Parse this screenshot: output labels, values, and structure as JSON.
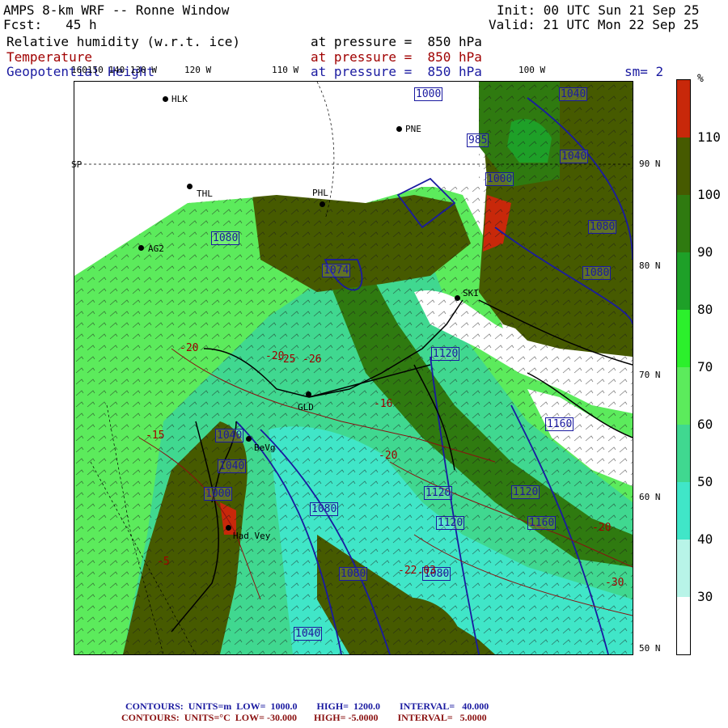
{
  "header": {
    "title": "AMPS 8-km WRF -- Ronne Window",
    "fcst": "Fcst:   45 h",
    "init": "Init: 00 UTC Sun 21 Sep 25",
    "valid": "Valid: 21 UTC Mon 22 Sep 25",
    "field1": "Relative humidity (w.r.t. ice)",
    "field2": "Temperature",
    "field3": "Geopotential Height",
    "level1": "at pressure =  850 hPa",
    "level2": "at pressure =  850 hPa",
    "level3": "at pressure =  850 hPa",
    "smooth": "sm= 2"
  },
  "top_longitudes": [
    "160150 140 130 W",
    "120 W",
    "110 W",
    "100 W"
  ],
  "right_latitudes": [
    "90 N",
    "80 N",
    "70 N",
    "60 N",
    "50 N"
  ],
  "left_edge_label": "SP",
  "colorbar": {
    "unit": "%",
    "ticks": [
      "110",
      "100",
      "90",
      "80",
      "70",
      "60",
      "50",
      "40",
      "30"
    ],
    "colors": [
      "#c8280a",
      "#465a00",
      "#2f7a10",
      "#1ea028",
      "#2cf02c",
      "#5ceb5c",
      "#40d890",
      "#40e6c8",
      "#b8f4e8",
      "#ffffff"
    ]
  },
  "stations": [
    {
      "name": "HLK"
    },
    {
      "name": "PNE"
    },
    {
      "name": "THL"
    },
    {
      "name": "PHL"
    },
    {
      "name": "AG2"
    },
    {
      "name": "SKI"
    },
    {
      "name": "GLD"
    },
    {
      "name": "BeVg"
    },
    {
      "name": "Had Vey"
    }
  ],
  "height_labels": [
    "1000",
    "1040",
    "985",
    "1040",
    "1000",
    "1080",
    "1080",
    "1080",
    "1074",
    "1040",
    "1120",
    "1120",
    "1160",
    "1000",
    "1040",
    "1080",
    "1080",
    "1120",
    "1120",
    "1160",
    "1080",
    "1040"
  ],
  "temp_labels": [
    "-20",
    "-20",
    "-15",
    "-20",
    "-25",
    "-26",
    "-16",
    "-5",
    "-22.03",
    "-20",
    "-30"
  ],
  "footer": {
    "line1": "CONTOURS:  UNITS=m  LOW=  1000.0        HIGH=  1200.0        INTERVAL=   40.000",
    "line2": "CONTOURS:  UNITS=°C  LOW= -30.000       HIGH= -5.0000        INTERVAL=   5.0000"
  }
}
